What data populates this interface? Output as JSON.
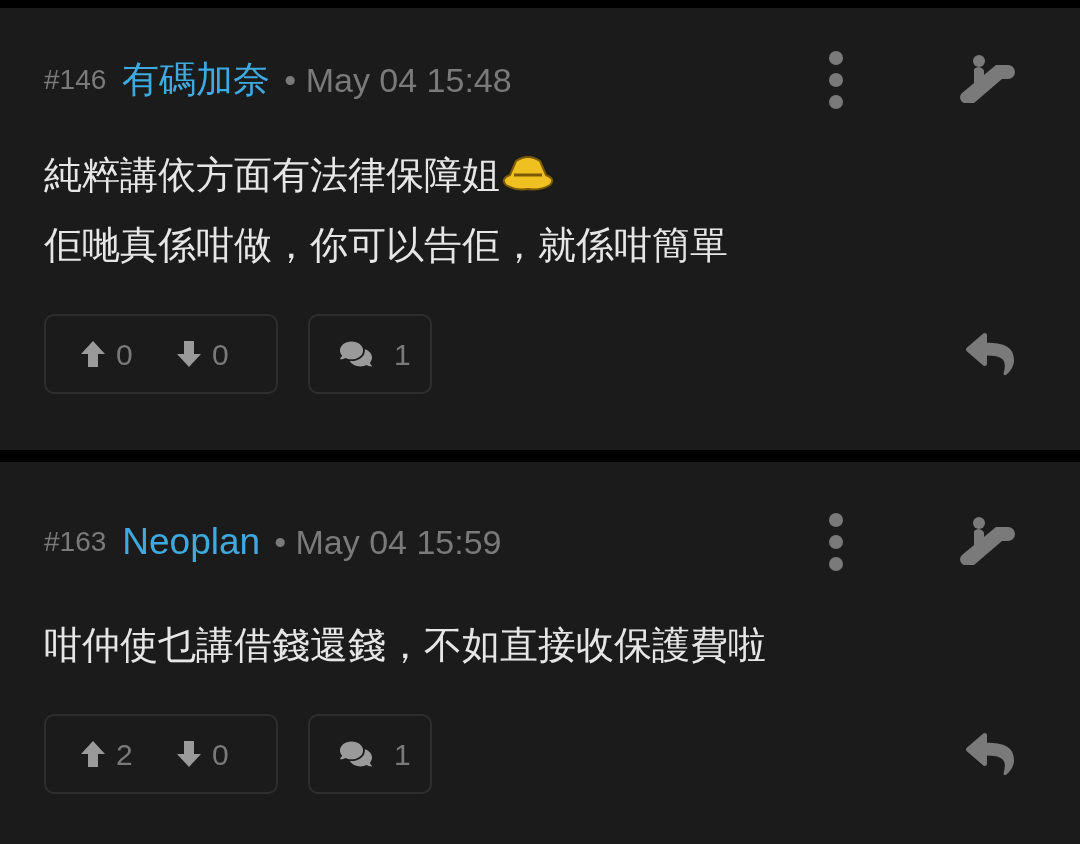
{
  "posts": [
    {
      "number": "#146",
      "author": "有碼加奈",
      "time": "• May 04 15:48",
      "lines": [
        {
          "text": "純粹講依方面有法律保障姐",
          "emoji": true
        },
        {
          "text": "佢哋真係咁做，你可以告佢，就係咁簡單",
          "emoji": false
        }
      ],
      "upvotes": "0",
      "downvotes": "0",
      "replies": "1"
    },
    {
      "number": "#163",
      "author": "Neoplan",
      "time": "• May 04 15:59",
      "lines": [
        {
          "text": "咁仲使乜講借錢還錢，不如直接收保護費啦",
          "emoji": false
        }
      ],
      "upvotes": "2",
      "downvotes": "0",
      "replies": "1"
    }
  ]
}
